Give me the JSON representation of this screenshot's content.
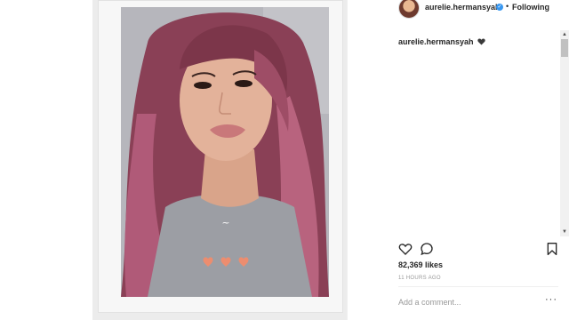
{
  "post": {
    "author": "aurelie.hermansyah",
    "verified_icon": "verified-badge-icon",
    "separator": "•",
    "follow_status": "Following",
    "caption_user": "aurelie.hermansyah",
    "caption_emoji_icon": "black-heart-icon",
    "likes": "82,369 likes",
    "timestamp": "11 HOURS AGO",
    "comment_placeholder": "Add a comment...",
    "more_label": "···"
  },
  "icons": {
    "like": "heart-outline-icon",
    "comment": "comment-bubble-icon",
    "save": "bookmark-icon"
  },
  "colors": {
    "accent_blue": "#3897f0",
    "text": "#262626",
    "muted": "#999999",
    "hair": "#a8566f",
    "shirt": "#9c9ea4",
    "shirt_hearts": "#ec8d6f"
  }
}
